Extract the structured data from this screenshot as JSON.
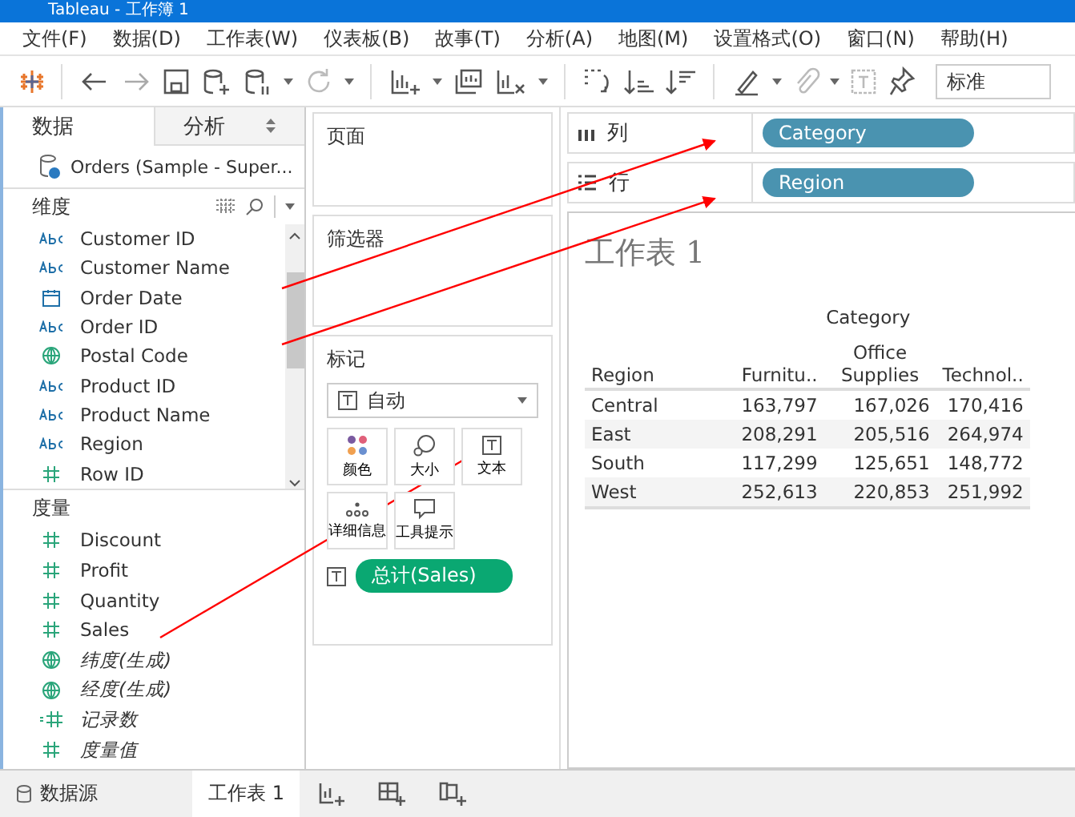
{
  "window": {
    "title": "Tableau - 工作簿 1"
  },
  "menu": [
    "文件(F)",
    "数据(D)",
    "工作表(W)",
    "仪表板(B)",
    "故事(T)",
    "分析(A)",
    "地图(M)",
    "设置格式(O)",
    "窗口(N)",
    "帮助(H)"
  ],
  "toolbar": {
    "fit": "标准"
  },
  "data_pane": {
    "tabs": [
      {
        "label": "数据",
        "selected": true
      },
      {
        "label": "分析",
        "selected": false
      }
    ],
    "datasource": "Orders (Sample - Super...",
    "dimensions": {
      "title": "维度",
      "fields": [
        {
          "name": "Customer ID",
          "kind": "string",
          "generated": false
        },
        {
          "name": "Customer Name",
          "kind": "string",
          "generated": false
        },
        {
          "name": "Order Date",
          "kind": "date",
          "generated": false
        },
        {
          "name": "Order ID",
          "kind": "string",
          "generated": false
        },
        {
          "name": "Postal Code",
          "kind": "geo",
          "generated": false
        },
        {
          "name": "Product ID",
          "kind": "string",
          "generated": false
        },
        {
          "name": "Product Name",
          "kind": "string",
          "generated": false
        },
        {
          "name": "Region",
          "kind": "string",
          "generated": false
        },
        {
          "name": "Row ID",
          "kind": "number",
          "generated": false
        }
      ]
    },
    "measures": {
      "title": "度量",
      "fields": [
        {
          "name": "Discount",
          "kind": "number",
          "generated": false
        },
        {
          "name": "Profit",
          "kind": "number",
          "generated": false
        },
        {
          "name": "Quantity",
          "kind": "number",
          "generated": false
        },
        {
          "name": "Sales",
          "kind": "number",
          "generated": false
        },
        {
          "name": "纬度(生成)",
          "kind": "geo",
          "generated": true
        },
        {
          "name": "经度(生成)",
          "kind": "geo",
          "generated": true
        },
        {
          "name": "记录数",
          "kind": "count",
          "generated": true
        },
        {
          "name": "度量值",
          "kind": "number",
          "generated": true
        }
      ]
    }
  },
  "cards": {
    "pages": "页面",
    "filters": "筛选器",
    "marks": {
      "title": "标记",
      "mark_type": "自动",
      "buttons": [
        {
          "label": "颜色",
          "kind": "color"
        },
        {
          "label": "大小",
          "kind": "size"
        },
        {
          "label": "文本",
          "kind": "text"
        },
        {
          "label": "详细信息",
          "kind": "detail"
        },
        {
          "label": "工具提示",
          "kind": "tooltip"
        }
      ],
      "pills": [
        {
          "label": "总计(Sales)"
        }
      ]
    }
  },
  "shelves": [
    {
      "label": "列",
      "kind": "columns",
      "pill": "Category"
    },
    {
      "label": "行",
      "kind": "rows",
      "pill": "Region"
    }
  ],
  "view": {
    "title": "工作表 1",
    "column_header": "Category",
    "row_header": "Region",
    "columns": [
      "Furnitu..",
      "Office Supplies",
      "Technol.."
    ],
    "rows": [
      {
        "label": "Central",
        "values": [
          "163,797",
          "167,026",
          "170,416"
        ]
      },
      {
        "label": "East",
        "values": [
          "208,291",
          "205,516",
          "264,974"
        ]
      },
      {
        "label": "South",
        "values": [
          "117,299",
          "125,651",
          "148,772"
        ]
      },
      {
        "label": "West",
        "values": [
          "252,613",
          "220,853",
          "251,992"
        ]
      }
    ]
  },
  "bottom_bar": {
    "datasource": "数据源",
    "sheets": [
      {
        "label": "工作表 1",
        "selected": true
      }
    ]
  }
}
